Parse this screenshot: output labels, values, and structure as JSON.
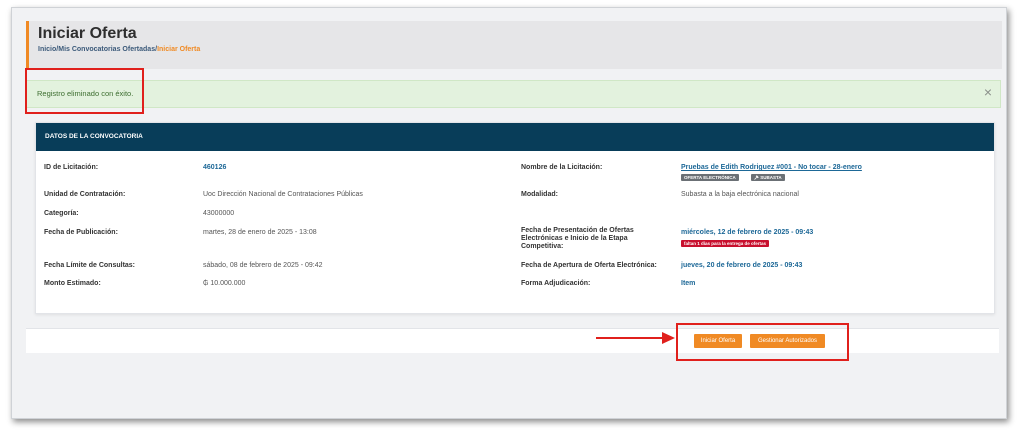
{
  "header": {
    "title": "Iniciar Oferta",
    "breadcrumb": {
      "home": "Inicio",
      "sep1": "/",
      "parent": "Mis Convocatorias Ofertadas",
      "sep2": "/",
      "current": "Iniciar Oferta"
    }
  },
  "alert": {
    "message": "Registro eliminado con éxito.",
    "close_icon": "×"
  },
  "card": {
    "title": "DATOS DE LA CONVOCATORIA",
    "left": [
      {
        "label": "ID de Licitación:",
        "value": "460126"
      },
      {
        "label": "Unidad de Contratación:",
        "value": "Uoc Dirección Nacional de Contrataciones Públicas"
      },
      {
        "label": "Categoría:",
        "value": "43000000"
      },
      {
        "label": "Fecha de Publicación:",
        "value": "martes, 28 de enero de 2025 - 13:08"
      },
      {
        "label": "Fecha Límite de Consultas:",
        "value": "sábado, 08 de febrero de 2025 - 09:42"
      },
      {
        "label": "Monto Estimado:",
        "value": "₲ 10.000.000"
      }
    ],
    "right": [
      {
        "label": "Nombre de la Licitación:",
        "value": "Pruebas de Edith Rodriguez #001 - No tocar - 28-enero"
      },
      {
        "label": "Modalidad:",
        "value": "Subasta a la baja electrónica nacional"
      },
      {
        "label": "Fecha de Presentación de Ofertas Electrónicas e Inicio de la Etapa Competitiva:",
        "value": "miércoles, 12 de febrero de 2025 - 09:43"
      },
      {
        "label": "Fecha de Apertura de Oferta Electrónica:",
        "value": "jueves, 20 de febrero de 2025 - 09:43"
      },
      {
        "label": "Forma Adjudicación:",
        "value": "Item"
      }
    ],
    "tags": {
      "electronic": "OFERTA ELECTRÓNICA",
      "auction": "SUBASTA",
      "auction_icon": "gavel-icon"
    },
    "deadline_badge": "faltan 1 días para la entrega de ofertas"
  },
  "actions": {
    "start_offer": "Iniciar Oferta",
    "manage": "Gestionar Autorizados"
  },
  "colors": {
    "accent": "#f08a24",
    "card_header": "#083d59",
    "link": "#1d6897",
    "annotation": "#e0201c",
    "alert_bg": "#e3f2de"
  }
}
